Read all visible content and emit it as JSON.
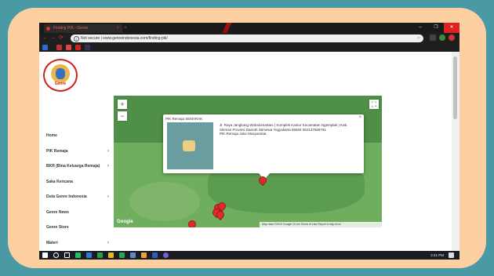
{
  "browser": {
    "tab_title": "Finding PIK - Genre",
    "tab_close": "×",
    "new_tab": "+",
    "url_security": "Not secure",
    "url": "www.genreindonesia.com/finding-pik/",
    "window_controls": [
      "–",
      "❐",
      "✕"
    ]
  },
  "site": {
    "logo_text": "Genre"
  },
  "menu": {
    "items": [
      {
        "label": "Home",
        "chevron": ""
      },
      {
        "label": "PIK Remaja",
        "chevron": "›"
      },
      {
        "label": "BKR (Bina Keluarga Remaja)",
        "chevron": "›"
      },
      {
        "label": "Saka Kencana",
        "chevron": ""
      },
      {
        "label": "Duta Genre Indonesia",
        "chevron": "›"
      },
      {
        "label": "Genre News",
        "chevron": ""
      },
      {
        "label": "Genre Store",
        "chevron": ""
      },
      {
        "label": "Materi",
        "chevron": "›"
      }
    ]
  },
  "map": {
    "zoom_in": "+",
    "zoom_out": "−",
    "fullscreen": "⛶",
    "google_label": "Google",
    "attribution": "Map data ©2019 Google   20 km        Terms of Use   Report a map error",
    "info": {
      "title": "PIK Remaja SEMARAK",
      "close": "×",
      "address": "Jl. Raya Jangkang Widodomartani ( Komplek Kantor Kecamatan Ngemplak ) Kab. Sleman Provinsi Daerah istimewa Yogyakarta 55584 082137559791",
      "type": "PIK Remaja Jalur Masyarakat"
    }
  },
  "taskbar": {
    "clock": "2:41 PM"
  },
  "colors": {
    "accent": "#e12b2b",
    "frame": "#fdd0a2",
    "background": "#4a9aa6"
  }
}
